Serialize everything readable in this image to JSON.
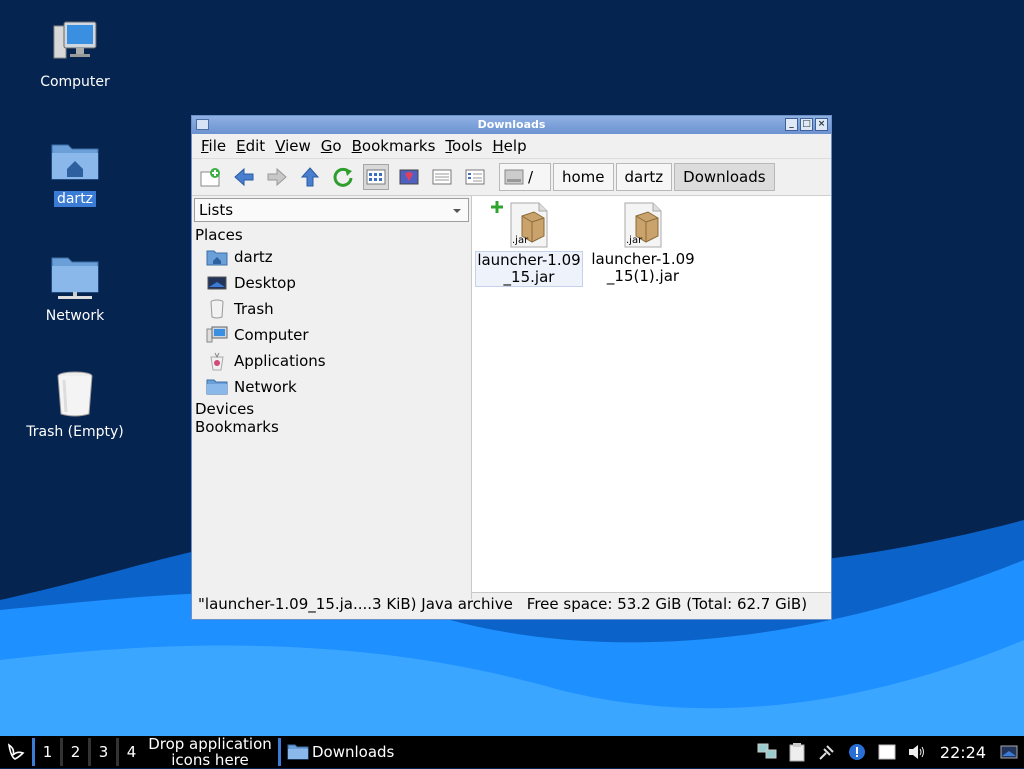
{
  "desktop": {
    "icons": [
      {
        "label": "Computer",
        "icon": "computer-icon"
      },
      {
        "label": "dartz",
        "icon": "home-folder-icon"
      },
      {
        "label": "Network",
        "icon": "network-folder-icon"
      },
      {
        "label": "Trash (Empty)",
        "icon": "trash-icon"
      }
    ]
  },
  "window": {
    "title": "Downloads",
    "menu": [
      "File",
      "Edit",
      "View",
      "Go",
      "Bookmarks",
      "Tools",
      "Help"
    ],
    "path": {
      "root": "/",
      "crumbs": [
        "home",
        "dartz",
        "Downloads"
      ]
    },
    "sidebar": {
      "mode": "Lists",
      "places_label": "Places",
      "places": [
        "dartz",
        "Desktop",
        "Trash",
        "Computer",
        "Applications",
        "Network"
      ],
      "devices_label": "Devices",
      "bookmarks_label": "Bookmarks"
    },
    "files": [
      {
        "line1": "launcher-1.09",
        "line2": "_15.jar",
        "badge": ".jar"
      },
      {
        "line1": "launcher-1.09",
        "line2": "_15(1).jar",
        "badge": ".jar"
      }
    ],
    "status": {
      "selection": "\"launcher-1.09_15.ja....3 KiB) Java archive",
      "space": "Free space: 53.2 GiB (Total: 62.7 GiB)"
    }
  },
  "taskbar": {
    "workspaces": [
      "1",
      "2",
      "3",
      "4"
    ],
    "drop_hint": "Drop application icons here",
    "task": "Downloads",
    "clock": "22:24"
  },
  "colors": {
    "accent": "#3a7bd5",
    "desktop_dark": "#062450",
    "wave": "#1e90ff"
  }
}
